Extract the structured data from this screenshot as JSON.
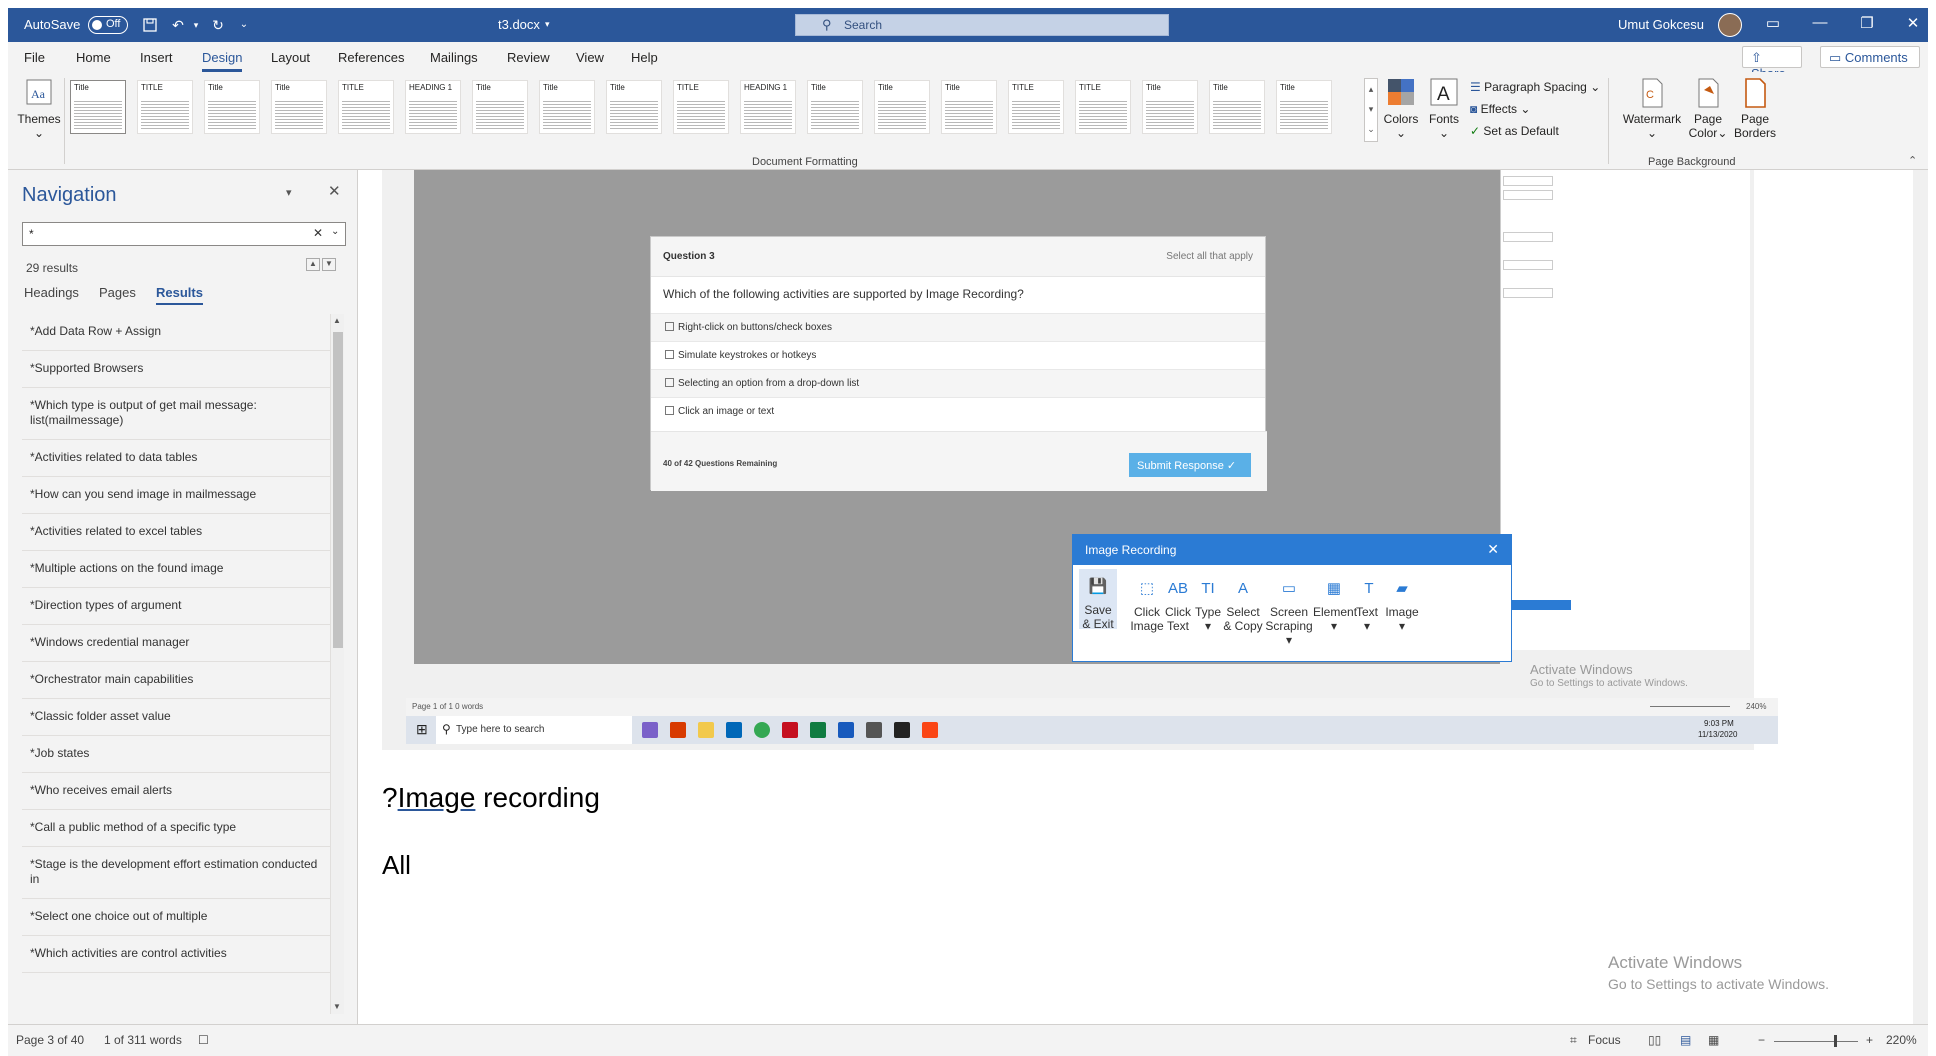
{
  "titlebar": {
    "autosave_label": "AutoSave",
    "autosave_state": "Off",
    "doc_name": "t3.docx",
    "search_placeholder": "Search",
    "user_name": "Umut Gokcesu"
  },
  "menu": {
    "items": [
      "File",
      "Home",
      "Insert",
      "Design",
      "Layout",
      "References",
      "Mailings",
      "Review",
      "View",
      "Help"
    ],
    "active": "Design",
    "share_label": "Share",
    "comments_label": "Comments"
  },
  "ribbon": {
    "themes_label": "Themes",
    "style_titles": [
      "Title",
      "TITLE",
      "Title",
      "Title",
      "TITLE",
      "HEADING 1",
      "Title",
      "Title",
      "Title",
      "TITLE",
      "HEADING 1",
      "Title",
      "Title",
      "Title",
      "TITLE",
      "TITLE",
      "Title",
      "Title",
      "Title"
    ],
    "colors_label": "Colors",
    "fonts_label": "Fonts",
    "paragraph_spacing_label": "Paragraph Spacing",
    "effects_label": "Effects",
    "set_default_label": "Set as Default",
    "document_formatting_label": "Document Formatting",
    "watermark_label": "Watermark",
    "page_color_label1": "Page",
    "page_color_label2": "Color",
    "page_borders_label1": "Page",
    "page_borders_label2": "Borders",
    "page_background_label": "Page Background"
  },
  "navigation": {
    "title": "Navigation",
    "search_value": "*",
    "results_count": "29 results",
    "tabs": [
      "Headings",
      "Pages",
      "Results"
    ],
    "active_tab": "Results",
    "results": [
      "*Add Data Row + Assign",
      "*Supported Browsers",
      "*Which type is output of get mail message: list(mailmessage)",
      "*Activities related to data tables",
      "*How can you send image in mailmessage",
      "*Activities related to excel tables",
      "*Multiple actions on the found image",
      "*Direction types of argument",
      "*Windows credential manager",
      "*Orchestrator main capabilities",
      "*Classic folder asset value",
      "*Job states",
      "*Who receives email alerts",
      "*Call a public method of a specific type",
      "*Stage is the development effort estimation conducted in",
      "*Select one choice out of multiple",
      "*Which activities are control activities"
    ]
  },
  "screenshot": {
    "question_number": "Question 3",
    "select_hint": "Select all that apply",
    "question_text": "Which of the following activities are supported by Image Recording?",
    "options": [
      "Right-click on buttons/check boxes",
      "Simulate keystrokes or hotkeys",
      "Selecting an option from a drop-down list",
      "Click an image or text"
    ],
    "remaining": "40 of 42 Questions Remaining",
    "submit_label": "Submit Response",
    "image_recording": {
      "title": "Image Recording",
      "buttons": [
        {
          "l1": "Save",
          "l2": "& Exit"
        },
        {
          "l1": "Click",
          "l2": "Image"
        },
        {
          "l1": "Click",
          "l2": "Text"
        },
        {
          "l1": "Type",
          "l2": "▾"
        },
        {
          "l1": "Select",
          "l2": "& Copy"
        },
        {
          "l1": "Screen",
          "l2": "Scraping ▾"
        },
        {
          "l1": "Element",
          "l2": "▾"
        },
        {
          "l1": "Text",
          "l2": "▾"
        },
        {
          "l1": "Image",
          "l2": "▾"
        }
      ]
    },
    "mini_status_left": "Page 1 of 1    0 words",
    "mini_status_zoom": "240%",
    "taskbar_search": "Type here to search",
    "taskbar_time": "9:03 PM",
    "taskbar_date": "11/13/2020",
    "inner_activate1": "Activate Windows",
    "inner_activate2": "Go to Settings to activate Windows."
  },
  "document": {
    "heading": "?Image recording",
    "heading_prefix": "?",
    "heading_underlined": "Image",
    "heading_rest": " recording",
    "para": "All"
  },
  "watermark": {
    "line1": "Activate Windows",
    "line2": "Go to Settings to activate Windows."
  },
  "statusbar": {
    "page": "Page 3 of 40",
    "words": "1 of 311 words",
    "focus": "Focus",
    "zoom": "220%"
  },
  "colors": {
    "word_blue": "#2b579a",
    "dialog_blue": "#2b7bd4",
    "submit_blue": "#5ab0e7"
  }
}
